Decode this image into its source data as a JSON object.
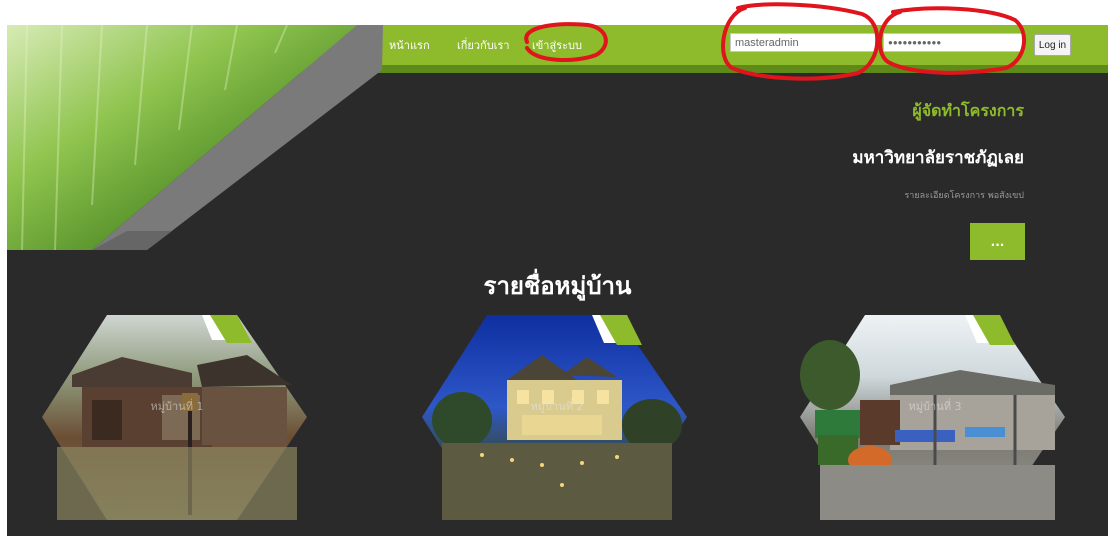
{
  "nav": {
    "home": "หน้าแรก",
    "about": "เกี่ยวกับเรา",
    "login": "เข้าสู่ระบบ"
  },
  "login_form": {
    "username_value": "masteradmin",
    "password_value": "●●●●●●●●●●●",
    "button_label": "Log in"
  },
  "hero": {
    "organizer_title": "ผู้จัดทำโครงการ",
    "university": "มหาวิทยาลัยราชภัฏเลย",
    "description": "รายละเอียดโครงการ พอสังเขป",
    "more_button": "..."
  },
  "villages": {
    "title": "รายชื่อหมู่บ้าน",
    "items": [
      {
        "label": "หมู่บ้านที่ 1"
      },
      {
        "label": "หมู่บ้านที่ 2"
      },
      {
        "label": "หมู่บ้านที่ 3"
      }
    ]
  },
  "colors": {
    "accent_green": "#8dbb2b",
    "background": "#2a2a2a",
    "annotation_red": "#e0141c"
  }
}
